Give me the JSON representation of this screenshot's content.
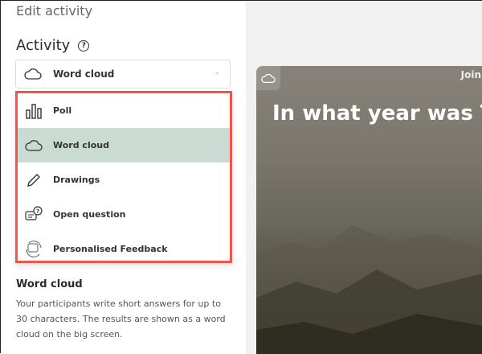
{
  "panel": {
    "title": "Edit activity",
    "activity_label": "Activity",
    "help": "?"
  },
  "select": {
    "value": "Word cloud",
    "icon": "cloud-icon"
  },
  "menu": {
    "items": [
      {
        "label": "Poll",
        "icon": "bar-chart-icon"
      },
      {
        "label": "Word cloud",
        "icon": "cloud-icon",
        "selected": true
      },
      {
        "label": "Drawings",
        "icon": "pencil-icon"
      },
      {
        "label": "Open question",
        "icon": "chat-question-icon"
      },
      {
        "label": "Personalised Feedback",
        "icon": "feedback-icon"
      }
    ]
  },
  "description": {
    "title": "Word cloud",
    "text": "Your participants write short answers for up to 30 characters. The results are shown as a word cloud on the big screen."
  },
  "preview": {
    "join": "Join",
    "question": "In what year was T"
  },
  "colors": {
    "highlight": "#c9dbd2",
    "menu_border": "#f0544a"
  }
}
